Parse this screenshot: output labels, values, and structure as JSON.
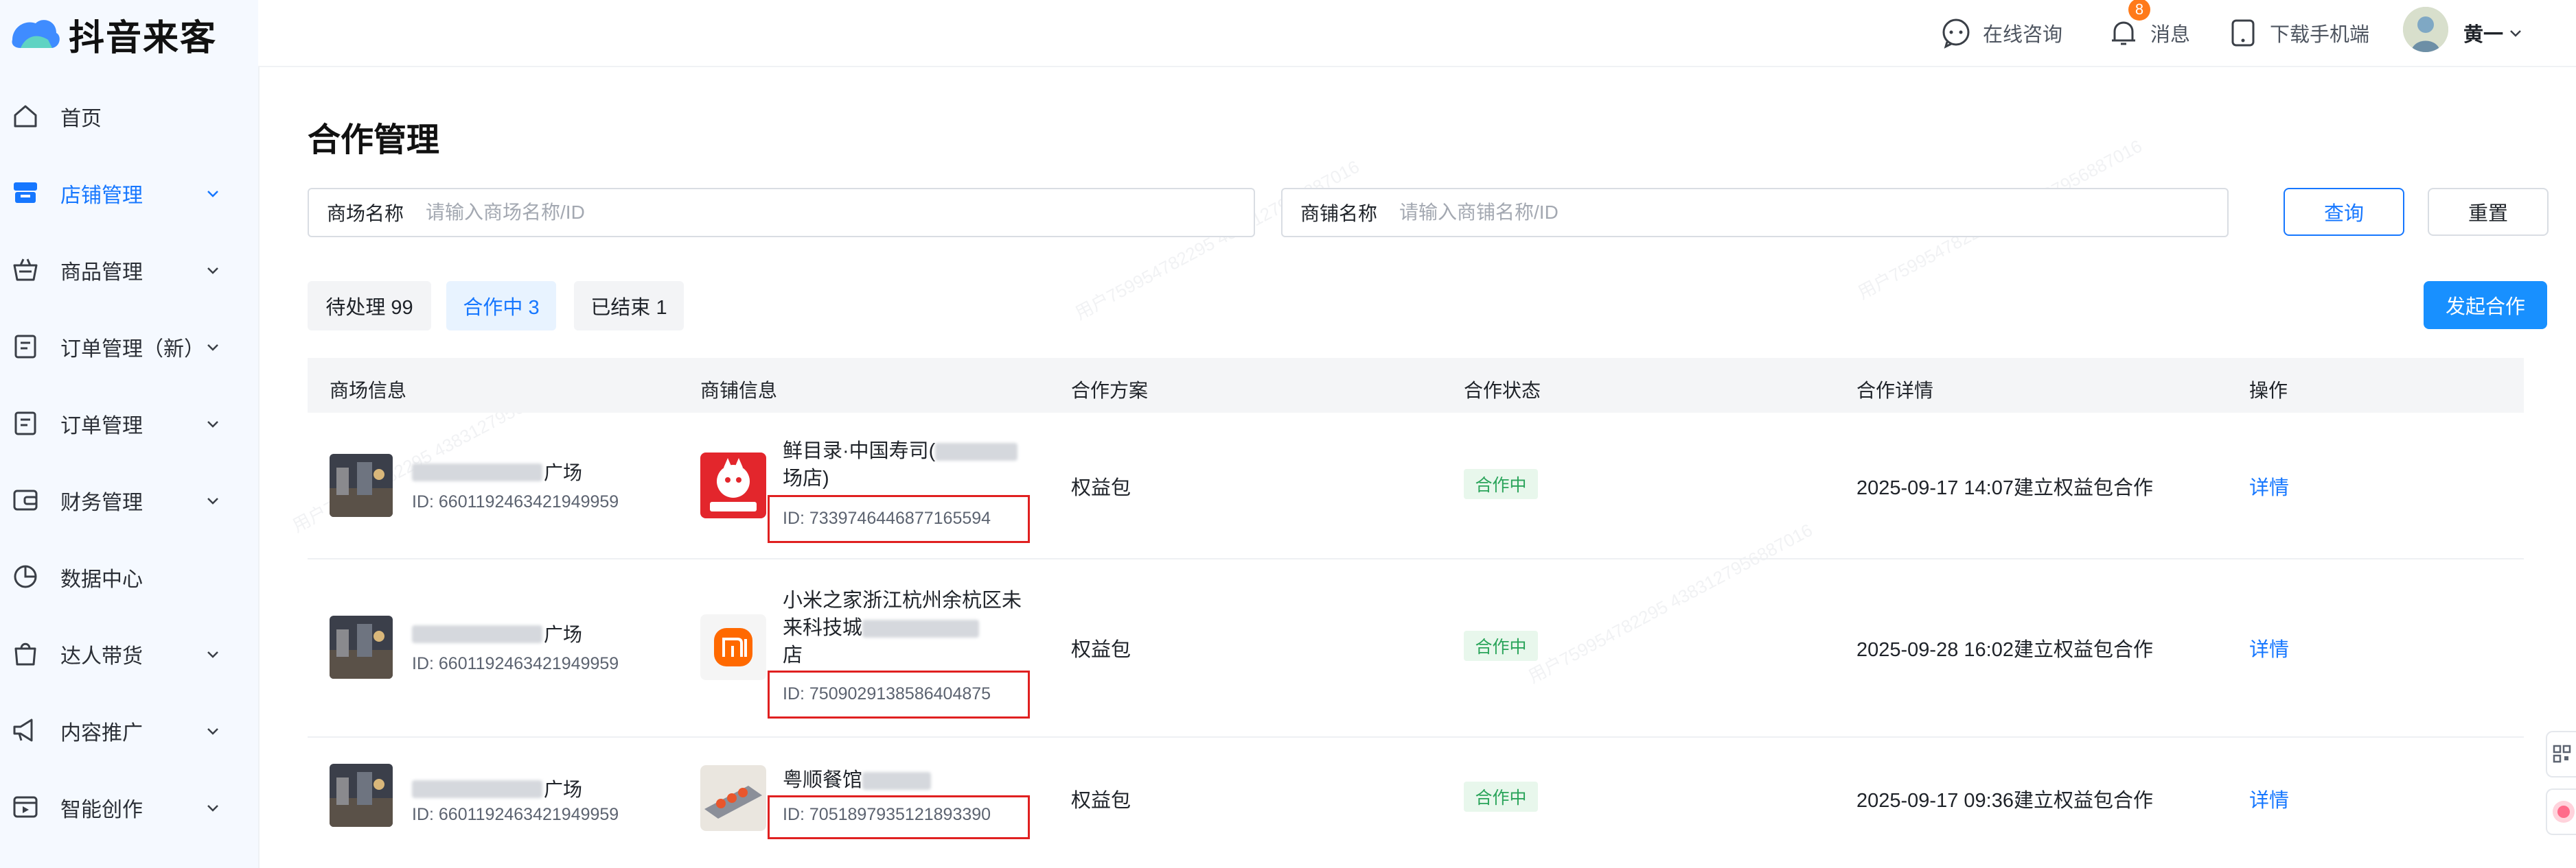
{
  "app": {
    "logo_text": "抖音来客"
  },
  "sidebar": {
    "items": [
      {
        "label": "首页",
        "icon": "home-icon",
        "has_chevron": false,
        "active": false
      },
      {
        "label": "店铺管理",
        "icon": "store-icon",
        "has_chevron": true,
        "active": true
      },
      {
        "label": "商品管理",
        "icon": "basket-icon",
        "has_chevron": true,
        "active": false
      },
      {
        "label": "订单管理（新）",
        "icon": "clipboard-icon",
        "has_chevron": true,
        "active": false
      },
      {
        "label": "订单管理",
        "icon": "clipboard-icon",
        "has_chevron": true,
        "active": false
      },
      {
        "label": "财务管理",
        "icon": "wallet-icon",
        "has_chevron": true,
        "active": false
      },
      {
        "label": "数据中心",
        "icon": "pie-chart-icon",
        "has_chevron": false,
        "active": false
      },
      {
        "label": "达人带货",
        "icon": "bag-icon",
        "has_chevron": true,
        "active": false
      },
      {
        "label": "内容推广",
        "icon": "megaphone-icon",
        "has_chevron": true,
        "active": false
      },
      {
        "label": "智能创作",
        "icon": "video-icon",
        "has_chevron": true,
        "active": false
      }
    ]
  },
  "header": {
    "consult": "在线咨询",
    "messages": "消息",
    "message_badge": "8",
    "download": "下载手机端",
    "user_name": "黄一"
  },
  "page": {
    "title": "合作管理"
  },
  "filters": {
    "mall_label": "商场名称",
    "mall_placeholder": "请输入商场名称/ID",
    "shop_label": "商铺名称",
    "shop_placeholder": "请输入商铺名称/ID",
    "query": "查询",
    "reset": "重置"
  },
  "tabs": [
    {
      "label": "待处理 99",
      "active": false
    },
    {
      "label": "合作中 3",
      "active": true
    },
    {
      "label": "已结束 1",
      "active": false
    }
  ],
  "start_button": "发起合作",
  "table": {
    "headers": [
      "商场信息",
      "商铺信息",
      "合作方案",
      "合作状态",
      "合作详情",
      "操作"
    ],
    "rows": [
      {
        "mall_name_suffix": "广场",
        "mall_id": "ID: 6601192463421949959",
        "shop_name_line1": "鲜目录·中国寿司(",
        "shop_name_line2": "场店)",
        "shop_name_line3": "",
        "shop_id": "ID: 7339746446877165594",
        "plan": "权益包",
        "status": "合作中",
        "detail": "2025-09-17 14:07建立权益包合作",
        "action": "详情"
      },
      {
        "mall_name_suffix": "广场",
        "mall_id": "ID: 6601192463421949959",
        "shop_name_line1": "小米之家浙江杭州余杭区未",
        "shop_name_line2": "来科技城",
        "shop_name_line3": "店",
        "shop_id": "ID: 7509029138586404875",
        "plan": "权益包",
        "status": "合作中",
        "detail": "2025-09-28 16:02建立权益包合作",
        "action": "详情"
      },
      {
        "mall_name_suffix": "广场",
        "mall_id": "ID: 6601192463421949959",
        "shop_name_line1": "粤顺餐馆",
        "shop_name_line2": "",
        "shop_name_line3": "",
        "shop_id": "ID: 7051897935121893390",
        "plan": "权益包",
        "status": "合作中",
        "detail": "2025-09-17 09:36建立权益包合作",
        "action": "详情"
      }
    ]
  },
  "colors": {
    "accent": "#1677ff",
    "status_green": "#2aa45a",
    "highlight_red": "#e02020"
  }
}
